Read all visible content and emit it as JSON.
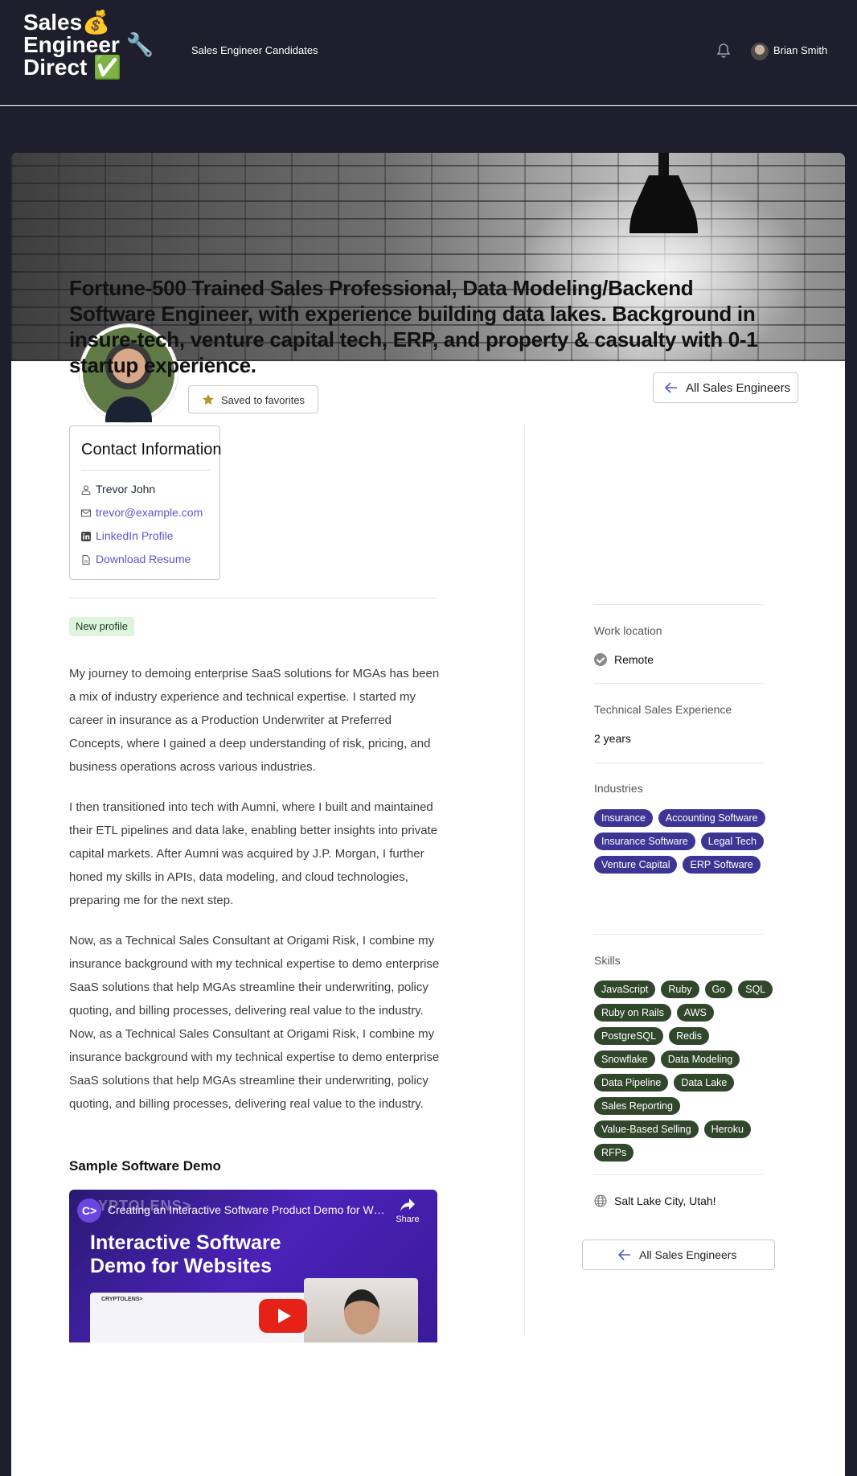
{
  "header": {
    "logo_line1": "Sales💰",
    "logo_line2": "Engineer 🔧",
    "logo_line3": "Direct ✅",
    "nav_link": "Sales Engineer Candidates",
    "user_name": "Brian Smith"
  },
  "profile": {
    "favorite_label": "Saved to favorites",
    "back_label": "All Sales Engineers",
    "headline": "Fortune-500 Trained Sales Professional, Data Modeling/Backend Software Engineer, with experience building data lakes. Background in insure-tech, venture capital tech, ERP, and property & casualty with 0-1 startup experience."
  },
  "contact": {
    "title": "Contact Information",
    "name": "Trevor John",
    "email": "trevor@example.com",
    "linkedin": "LinkedIn Profile",
    "resume": "Download Resume"
  },
  "status_badge": "New profile",
  "bio": [
    "My journey to demoing enterprise SaaS solutions for MGAs has been a mix of industry experience and technical expertise. I started my career in insurance as a Production Underwriter at Preferred Concepts, where I gained a deep understanding of risk, pricing, and business operations across various industries.",
    "I then transitioned into tech with Aumni, where I built and maintained their ETL pipelines and data lake, enabling better insights into private capital markets. After Aumni was acquired by J.P. Morgan, I further honed my skills in APIs, data modeling, and cloud technologies, preparing me for the next step.",
    "Now, as a Technical Sales Consultant at Origami Risk, I combine my insurance background with my technical expertise to demo enterprise SaaS solutions that help MGAs streamline their underwriting, policy quoting, and billing processes, delivering real value to the industry. Now, as a Technical Sales Consultant at Origami Risk, I combine my insurance background with my technical expertise to demo enterprise SaaS solutions that help MGAs streamline their underwriting, policy quoting, and billing processes, delivering real value to the industry."
  ],
  "demo": {
    "section_title": "Sample Software Demo",
    "video_title": "Creating an Interactive Software Product Demo for Web...",
    "share_label": "Share",
    "overlay_line1": "Interactive Software",
    "overlay_line2": "Demo for Websites",
    "watermark": "YPTOLENS>",
    "logo_glyph": "C>",
    "shot_brand": "CRYPTOLENS>"
  },
  "sidebar": {
    "work_location_label": "Work location",
    "work_location_value": "Remote",
    "experience_label": "Technical Sales Experience",
    "experience_value": "2 years",
    "industries_label": "Industries",
    "industries": [
      "Insurance",
      "Accounting Software",
      "Insurance Software",
      "Legal Tech",
      "Venture Capital",
      "ERP Software"
    ],
    "skills_label": "Skills",
    "skills": [
      "JavaScript",
      "Ruby",
      "Go",
      "SQL",
      "Ruby on Rails",
      "AWS",
      "PostgreSQL",
      "Redis",
      "Snowflake",
      "Data Modeling",
      "Data Pipeline",
      "Data Lake",
      "Sales Reporting",
      "Value-Based Selling",
      "Heroku",
      "RFPs"
    ],
    "location": "Salt Lake City, Utah!",
    "back_label": "All Sales Engineers"
  },
  "colors": {
    "nav_bg": "#1e1e2c",
    "link": "#5b57d1",
    "industry_tag": "#3d3594",
    "skill_tag": "#31472c",
    "badge_bg": "#dcf5dc"
  }
}
